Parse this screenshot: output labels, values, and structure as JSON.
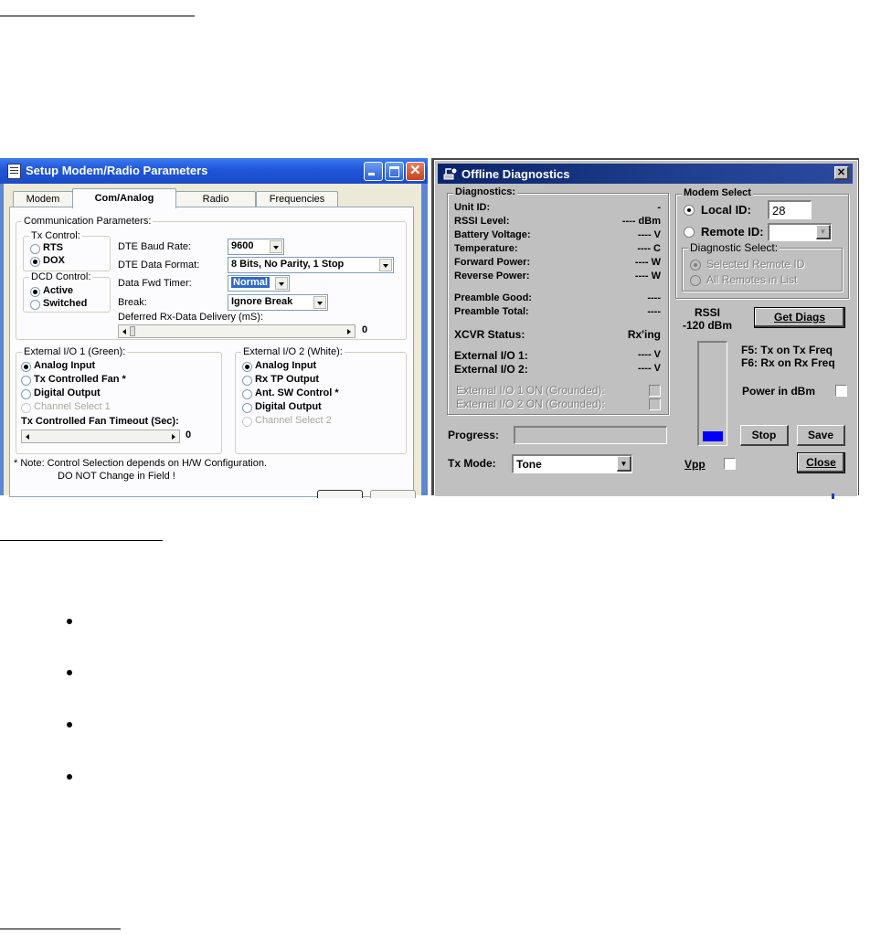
{
  "setup_window": {
    "title": "Setup Modem/Radio Parameters",
    "tabs": [
      "Modem",
      "Com/Analog",
      "Radio",
      "Frequencies"
    ],
    "active_tab": "Com/Analog",
    "comm_params_label": "Communication Parameters:",
    "tx_control": {
      "label": "Tx Control:",
      "options": [
        "RTS",
        "DOX"
      ],
      "selected": "DOX"
    },
    "dcd_control": {
      "label": "DCD Control:",
      "options": [
        "Active",
        "Switched"
      ],
      "selected": "Active"
    },
    "dte_baud_rate": {
      "label": "DTE Baud Rate:",
      "value": "9600"
    },
    "dte_data_format": {
      "label": "DTE Data Format:",
      "value": "8 Bits, No Parity, 1 Stop"
    },
    "data_fwd_timer": {
      "label": "Data Fwd Timer:",
      "value": "Normal"
    },
    "break": {
      "label": "Break:",
      "value": "Ignore Break"
    },
    "deferred": {
      "label": "Deferred Rx-Data Delivery (mS):",
      "value": "0"
    },
    "ext_io1": {
      "label": "External I/O 1 (Green):",
      "options": [
        "Analog Input",
        "Tx Controlled Fan *",
        "Digital Output",
        "Channel Select 1"
      ],
      "selected": "Analog Input"
    },
    "fan_timeout": {
      "label": "Tx Controlled Fan Timeout (Sec):",
      "value": "0"
    },
    "ext_io2": {
      "label": "External I/O 2 (White):",
      "options": [
        "Analog Input",
        "Rx TP Output",
        "Ant. SW Control *",
        "Digital Output",
        "Channel Select 2"
      ],
      "selected": "Analog Input"
    },
    "note_line1": "* Note:  Control Selection depends on H/W Configuration.",
    "note_line2": "DO NOT Change in Field !"
  },
  "diag_window": {
    "title": "Offline Diagnostics",
    "diagnostics_label": "Diagnostics:",
    "rows": [
      {
        "label": "Unit ID:",
        "value": "-"
      },
      {
        "label": "RSSI Level:",
        "value": "---- dBm"
      },
      {
        "label": "Battery Voltage:",
        "value": "---- V"
      },
      {
        "label": "Temperature:",
        "value": "---- C"
      },
      {
        "label": "Forward Power:",
        "value": "---- W"
      },
      {
        "label": "Reverse Power:",
        "value": "---- W"
      },
      {
        "label": "Preamble Good:",
        "value": "----"
      },
      {
        "label": "Preamble Total:",
        "value": "----"
      },
      {
        "label": "XCVR Status:",
        "value": "Rx'ing"
      },
      {
        "label": "External I/O 1:",
        "value": "---- V"
      },
      {
        "label": "External I/O 2:",
        "value": "---- V"
      }
    ],
    "ext_io1_on": "External I/O 1 ON (Grounded):",
    "ext_io2_on": "External I/O 2 ON (Grounded):",
    "modem_select_label": "Modem Select",
    "local_id_label": "Local ID:",
    "local_id_value": "28",
    "remote_id_label": "Remote ID:",
    "remote_id_value": "",
    "diag_select_label": "Diagnostic Select:",
    "diag_select_options": [
      "Selected Remote ID",
      "All Remotes in List"
    ],
    "rssi_label": "RSSI",
    "rssi_value": "-120 dBm",
    "rssi_fill_fraction": 0.1,
    "get_diags": "Get Diags",
    "f5": "F5: Tx on Tx Freq",
    "f6": "F6: Rx on Rx Freq",
    "power_in_dbm": "Power in dBm",
    "progress_label": "Progress:",
    "tx_mode_label": "Tx Mode:",
    "tx_mode_value": "Tone",
    "vpp_label": "Vpp",
    "stop": "Stop",
    "save": "Save",
    "close": "Close",
    "accent": "#0000ff"
  }
}
